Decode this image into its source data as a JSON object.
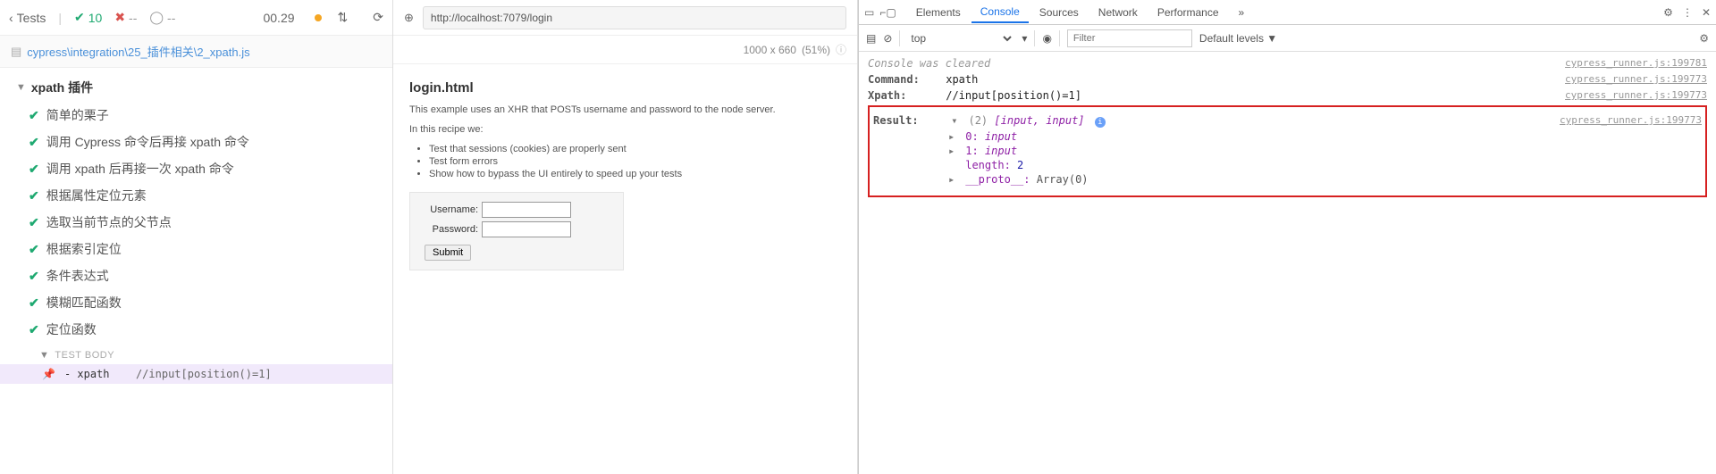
{
  "sidebar": {
    "back_label": "Tests",
    "pass_count": "10",
    "fail_count": "--",
    "pending_count": "--",
    "timer": "00.29",
    "file_path": "cypress\\integration\\25_插件相关\\2_xpath.js",
    "suite_title": "xpath 插件",
    "tests": [
      "简单的栗子",
      "调用 Cypress 命令后再接 xpath 命令",
      "调用 xpath 后再接一次 xpath 命令",
      "根据属性定位元素",
      "选取当前节点的父节点",
      "根据索引定位",
      "条件表达式",
      "模糊匹配函数",
      "定位函数"
    ],
    "body_label": "TEST BODY",
    "cmd_name": "- xpath",
    "cmd_arg": "//input[position()=1]"
  },
  "preview": {
    "url": "http://localhost:7079/login",
    "viewport": "1000 x 660",
    "scale": "(51%)",
    "title": "login.html",
    "desc": "This example uses an XHR that POSTs username and password to the node server.",
    "recipe_intro": "In this recipe we:",
    "bullets": [
      "Test that sessions (cookies) are properly sent",
      "Test form errors",
      "Show how to bypass the UI entirely to speed up your tests"
    ],
    "username_label": "Username:",
    "password_label": "Password:",
    "submit_label": "Submit"
  },
  "devtools": {
    "tabs": [
      "Elements",
      "Console",
      "Sources",
      "Network",
      "Performance"
    ],
    "active_tab": "Console",
    "more": "»",
    "context": "top",
    "filter_placeholder": "Filter",
    "levels": "Default levels ▼",
    "cleared": "Console was cleared",
    "command_label": "Command:",
    "command_value": "xpath",
    "xpath_label": "Xpath:",
    "xpath_value": "//input[position()=1]",
    "result_label": "Result:",
    "result_summary_count": "(2)",
    "result_summary_items": "[input, input]",
    "tree": {
      "item0_key": "0:",
      "item0_val": "input",
      "item1_key": "1:",
      "item1_val": "input",
      "length_key": "length:",
      "length_val": "2",
      "proto_key": "__proto__:",
      "proto_val": "Array(0)"
    },
    "sources": {
      "s1": "cypress_runner.js:199781",
      "s2": "cypress_runner.js:199773",
      "s3": "cypress_runner.js:199773",
      "s4": "cypress_runner.js:199773"
    }
  }
}
